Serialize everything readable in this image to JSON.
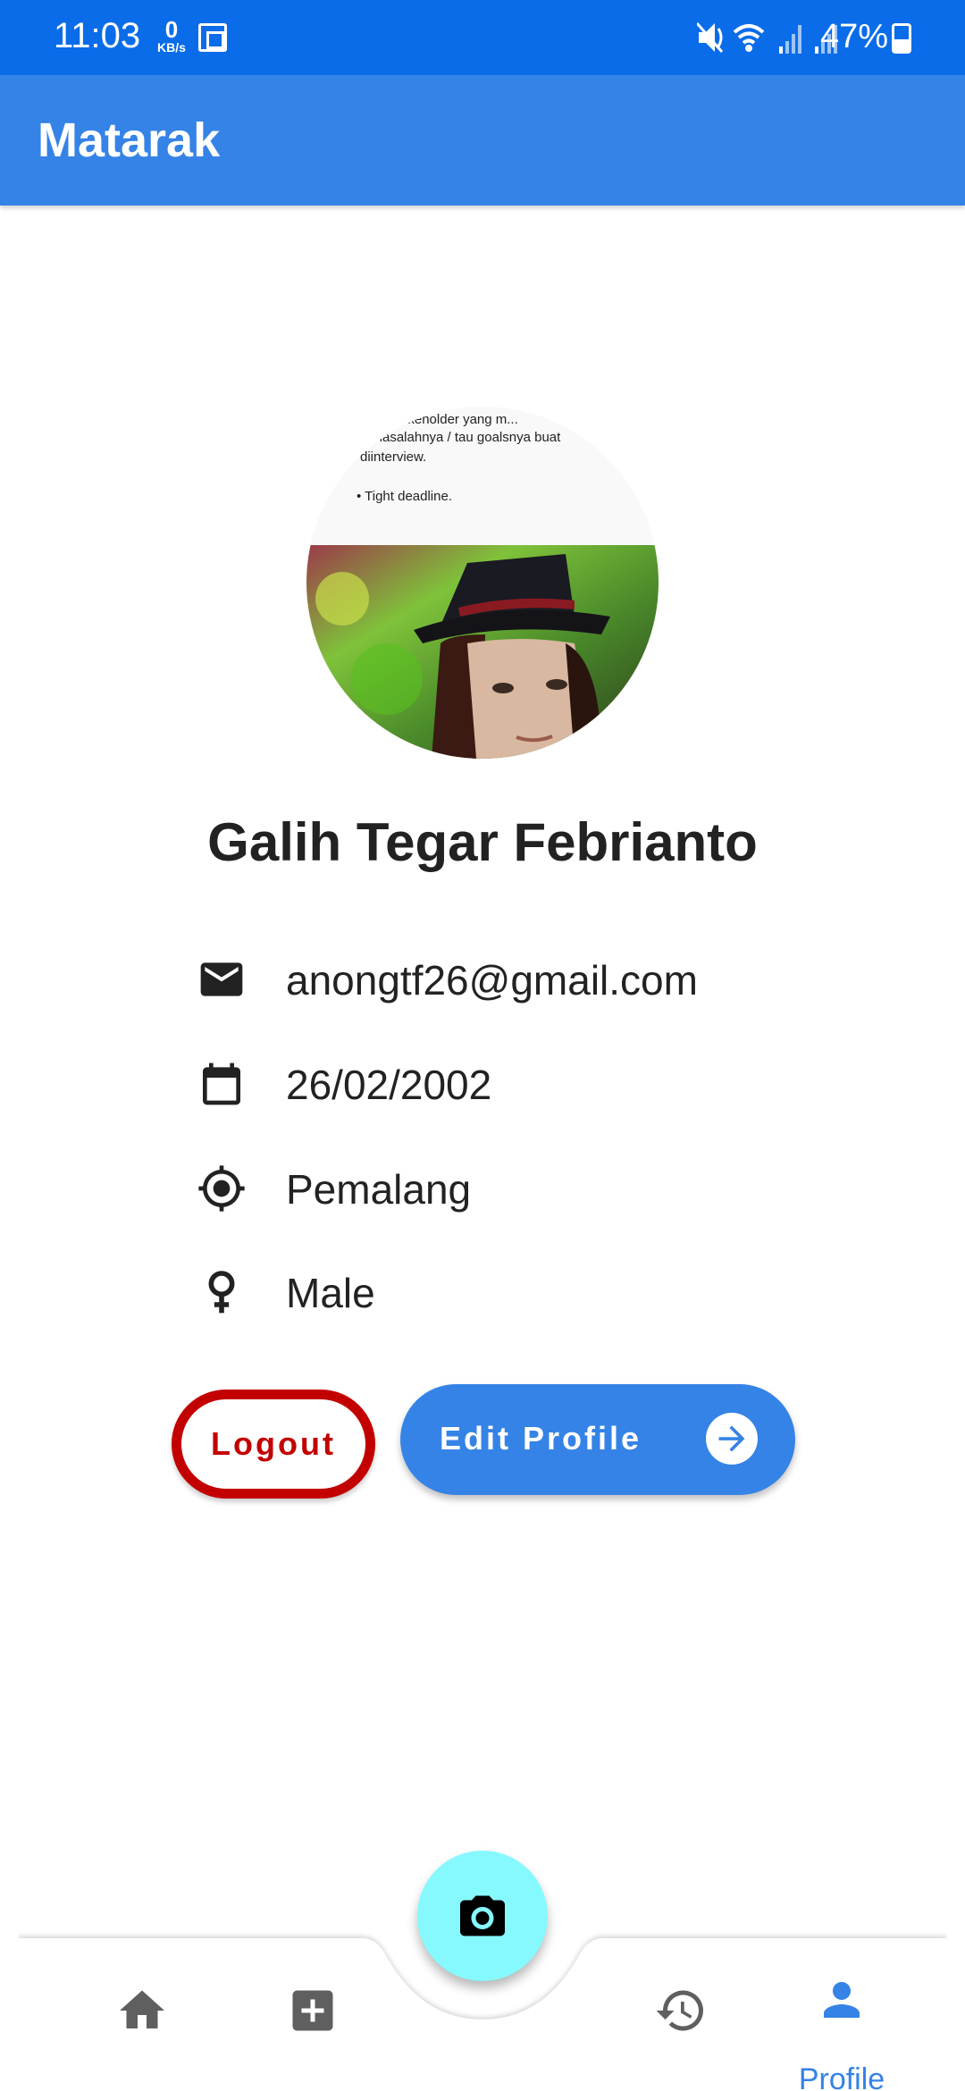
{
  "status_bar": {
    "time": "11:03",
    "net_speed_value": "0",
    "net_speed_unit": "KB/s",
    "battery": "47%"
  },
  "app_bar": {
    "title": "Matarak"
  },
  "avatar": {
    "doc_lines": [
      "...ua stakeholder yang m...",
      "...masalahnya / tau goalsnya buat",
      "diinterview.",
      "•  Tight deadline."
    ]
  },
  "profile": {
    "name": "Galih Tegar Febrianto",
    "email": "anongtf26@gmail.com",
    "birth_date": "26/02/2002",
    "location": "Pemalang",
    "gender": "Male"
  },
  "actions": {
    "logout_label": "Logout",
    "edit_label": "Edit Profile"
  },
  "bottom_nav": {
    "active": "profile",
    "profile_label": "Profile"
  },
  "colors": {
    "status_bar": "#0a6ce9",
    "primary": "#3583e6",
    "logout": "#c30000",
    "fab": "#86f9ff"
  }
}
